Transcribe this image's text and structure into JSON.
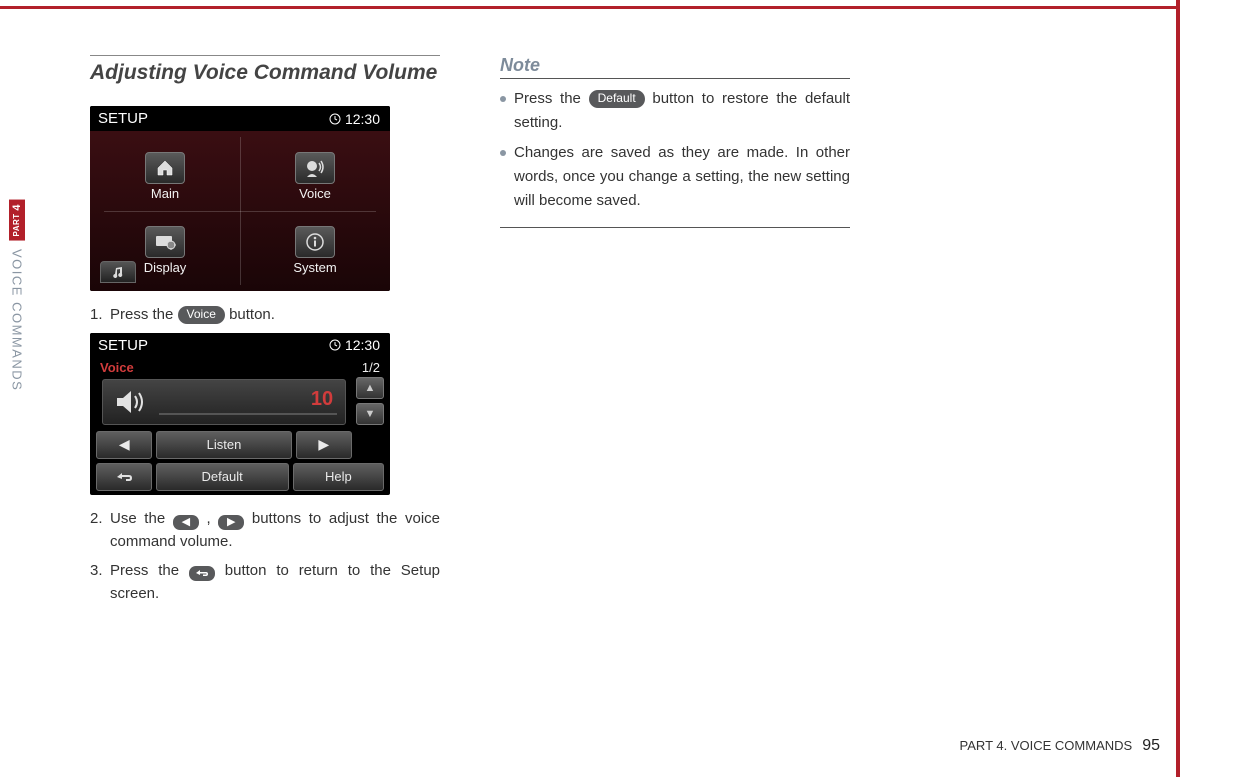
{
  "page": {
    "footer_label": "PART 4. VOICE COMMANDS",
    "page_number": "95",
    "side_tab_part": "PART",
    "side_tab_number": "4",
    "side_tab_section": "VOICE COMMANDS"
  },
  "left": {
    "title": "Adjusting Voice Command Volume",
    "setup_screenshot": {
      "title": "SETUP",
      "clock": "12:30",
      "items": {
        "main": "Main",
        "voice": "Voice",
        "display": "Display",
        "system": "System"
      }
    },
    "step1": {
      "num": "1.",
      "before": " Press the ",
      "pill": "Voice",
      "after": " button."
    },
    "voice_screenshot": {
      "title": "SETUP",
      "clock": "12:30",
      "voice_label": "Voice",
      "page_indicator": "1/2",
      "volume_value": "10",
      "listen_label": "Listen",
      "default_label": "Default",
      "help_label": "Help"
    },
    "step2": {
      "num": "2.",
      "before": " Use the ",
      "mid": ", ",
      "after": " buttons to adjust the voice command volume."
    },
    "step3": {
      "num": "3.",
      "before": " Press the ",
      "after": " button to return to the Setup screen."
    }
  },
  "right": {
    "note_title": "Note",
    "note1": {
      "before": "Press the ",
      "pill": "Default",
      "after": " button to restore the default setting."
    },
    "note2": "Changes are saved as they are made. In other words, once you change a setting, the new setting will become saved."
  }
}
